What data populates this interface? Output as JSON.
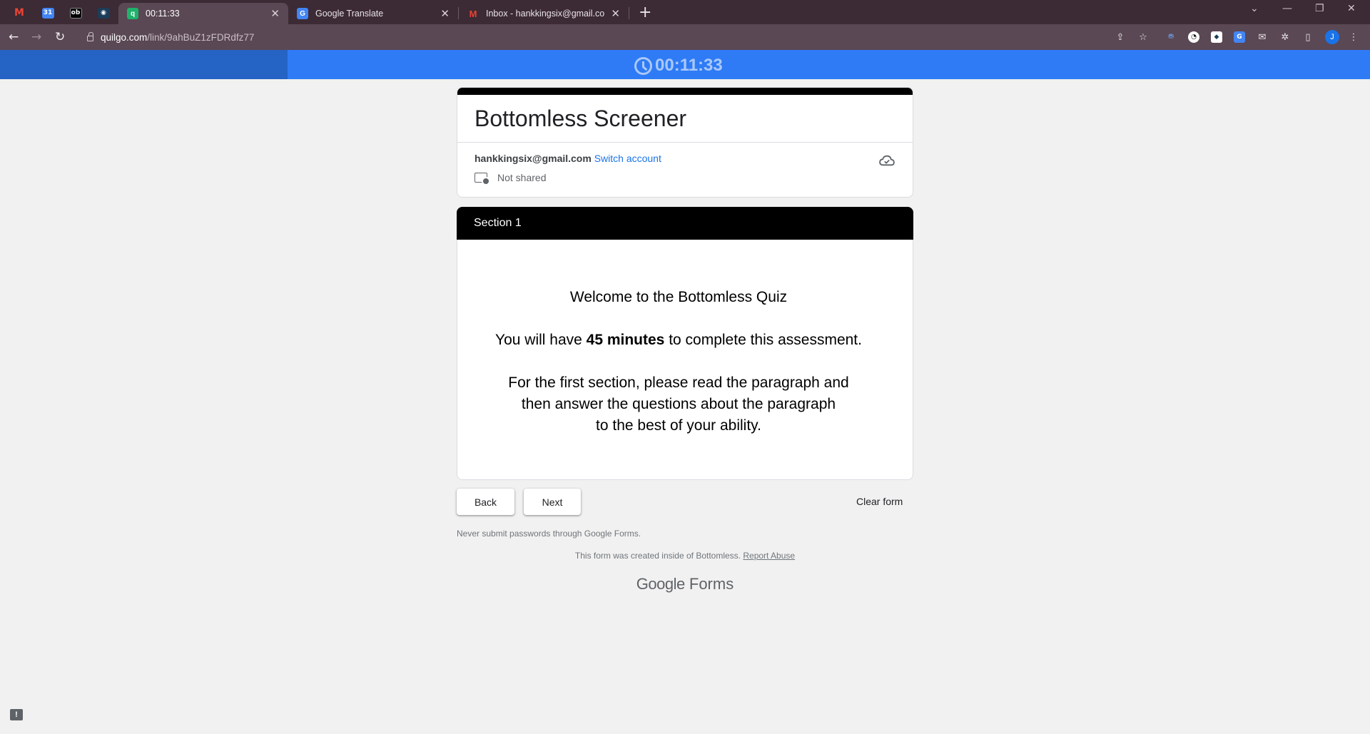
{
  "browser": {
    "pinned_tabs": [
      {
        "icon": "gmail-icon",
        "label": "M",
        "color": "#ea4335"
      },
      {
        "icon": "calendar-icon",
        "label": "31",
        "color": "#4285f4"
      },
      {
        "icon": "app-icon",
        "label": "ob",
        "color": "#000000"
      },
      {
        "icon": "app-icon",
        "label": "◉",
        "color": "#1c3d5a"
      }
    ],
    "tabs": [
      {
        "title": "00:11:33",
        "icon_label": "q",
        "icon_color": "#1fb26b",
        "active": true
      },
      {
        "title": "Google Translate",
        "icon_label": "G",
        "icon_color": "#4285f4",
        "active": false
      },
      {
        "title": "Inbox - hankkingsix@gmail.com",
        "icon_label": "M",
        "icon_color": "#ea4335",
        "active": false
      }
    ],
    "url_host": "quilgo.com",
    "url_path": "/link/9ahBuZ1zFDRdfz77",
    "profile_initial": "J"
  },
  "timer": {
    "display": "00:11:33",
    "progress_fraction": 0.21
  },
  "form": {
    "title": "Bottomless Screener",
    "account_email": "hankkingsix@gmail.com",
    "switch_account": "Switch account",
    "not_shared": "Not shared",
    "section_title": "Section 1",
    "welcome_line": "Welcome to the Bottomless Quiz",
    "time_prefix": "You will have ",
    "time_bold": "45 minutes",
    "time_suffix": " to complete this assessment.",
    "instructions_1": "For the first section, please read the paragraph and",
    "instructions_2": "then answer the questions about the paragraph",
    "instructions_3": "to the best of your ability.",
    "back_label": "Back",
    "next_label": "Next",
    "clear_label": "Clear form",
    "never_submit": "Never submit passwords through Google Forms.",
    "created_text": "This form was created inside of Bottomless.",
    "report_abuse": "Report Abuse",
    "brand_google": "Google",
    "brand_forms": "Forms"
  }
}
